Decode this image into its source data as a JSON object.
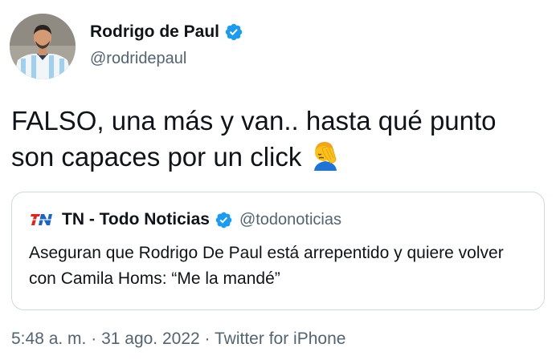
{
  "author": {
    "name": "Rodrigo de Paul",
    "handle": "@rodridepaul",
    "verified": true
  },
  "tweet": {
    "text": "FALSO, una más y van.. hasta qué punto son capaces por un click",
    "emoji": "facepalm-icon"
  },
  "quote": {
    "logo_icon": "tn-logo-icon",
    "name": "TN - Todo Noticias",
    "handle": "@todonoticias",
    "verified": true,
    "text": "Aseguran que Rodrigo De Paul está arrepentido y quiere volver con Camila Homs: “Me la mandé”"
  },
  "meta": {
    "time": "5:48 a. m.",
    "separator": "·",
    "date": "31 ago. 2022",
    "source": "Twitter for iPhone"
  },
  "colors": {
    "text": "#0f1419",
    "secondary": "#536471",
    "verified": "#1d9bf0",
    "border": "#cfd9de"
  }
}
